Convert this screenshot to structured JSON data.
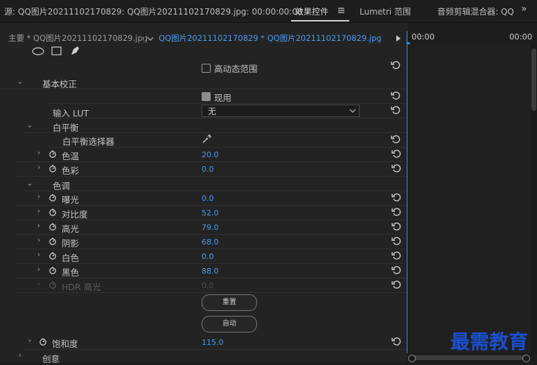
{
  "tabs": {
    "source": "源: QQ图片20211102170829: QQ图片20211102170829.jpg: 00:00:00:00",
    "effects": "效果控件",
    "lumetri": "Lumetri 范围",
    "audio_mixer": "音频剪辑混合器: QQ",
    "more": "»"
  },
  "subbar": {
    "master": "主要 * QQ图片20211102170829.jpg",
    "clip": "QQ图片20211102170829 * QQ图片20211102170829.jpg",
    "tc_left": "00:00",
    "tc_right": "00:00"
  },
  "hdr_range": "高动态范围",
  "basic_correction": {
    "title": "基本校正",
    "enabled_label": "现用",
    "input_lut_label": "输入 LUT",
    "input_lut_value": "无",
    "white_balance": {
      "title": "白平衡",
      "picker_label": "白平衡选择器",
      "params": [
        {
          "label": "色温",
          "value": "20.0"
        },
        {
          "label": "色彩",
          "value": "0.0"
        }
      ]
    },
    "tone": {
      "title": "色调",
      "params": [
        {
          "label": "曝光",
          "value": "0.0"
        },
        {
          "label": "对比度",
          "value": "52.0"
        },
        {
          "label": "高光",
          "value": "79.0"
        },
        {
          "label": "阴影",
          "value": "68.0"
        },
        {
          "label": "白色",
          "value": "0.0"
        },
        {
          "label": "黑色",
          "value": "88.0"
        },
        {
          "label": "HDR 高光",
          "value": "0.0"
        }
      ]
    },
    "reset_button": "重置",
    "auto_button": "自动",
    "saturation": {
      "label": "饱和度",
      "value": "115.0"
    }
  },
  "creative": "创意",
  "watermark": "最需教育",
  "colors": {
    "accent": "#4a9cf2",
    "timeline_line": "#3a8ee6",
    "watermark": "#1a4fd0"
  }
}
